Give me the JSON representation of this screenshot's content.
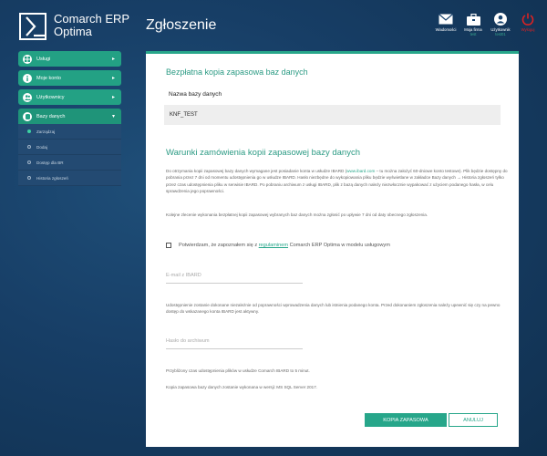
{
  "app": {
    "brand_line1": "Comarch ERP",
    "brand_line2": "Optima",
    "page_title": "Zgłoszenie"
  },
  "top_actions": [
    {
      "label": "Wiadomości",
      "sub": "",
      "icon": "envelope-icon"
    },
    {
      "label": "Moja firma",
      "sub": "test",
      "icon": "briefcase-icon"
    },
    {
      "label": "Użytkownik",
      "sub": "test01",
      "icon": "user-icon"
    },
    {
      "label": "Wyloguj",
      "sub": "",
      "icon": "power-icon"
    }
  ],
  "sidebar": {
    "items": [
      {
        "label": "Usługi",
        "icon": "grid-icon",
        "arrow": "▸"
      },
      {
        "label": "Moje konto",
        "icon": "info-icon",
        "arrow": "▸"
      },
      {
        "label": "Użytkownicy",
        "icon": "users-icon",
        "arrow": "▸"
      },
      {
        "label": "Bazy danych",
        "icon": "database-icon",
        "arrow": "▾"
      }
    ],
    "submenu": [
      {
        "label": "Zarządzaj",
        "current": true
      },
      {
        "label": "Dodaj",
        "current": false
      },
      {
        "label": "Dostęp dla BR",
        "current": false
      },
      {
        "label": "Historia zgłoszeń",
        "current": false
      }
    ]
  },
  "main": {
    "section1_title": "Bezpłatna kopia zapasowa baz danych",
    "table_header": "Nazwa bazy danych",
    "table_row": "KNF_TEST",
    "section2_title": "Warunki zamówienia kopii zapasowej bazy danych",
    "para1_a": "Do otrzymania kopii zapasowej bazy danych wymagane jest posiadanie konta w usłudze IBARD (",
    "para1_link": "www.ibard.com",
    "para1_b": " – tu można założyć 60-dniowe konto testowe). Plik będzie dostępny do pobrania przez 7 dni od momentu udostępnienia go w usłudze IBARD. Hasło niezbędne do wykopiowania pliku będzie wyświetlane w zakładce Bazy danych → Historia zgłoszeń tylko przez czas udostępnienia pliku w serwisie IBARD. Po pobraniu archiwum z usługi IBARD, plik z bazą danych należy niezwłocznie wypakować z użyciem podanego hasła, w celu sprawdzenia jego poprawności.",
    "para2": "Kolejne zlecenie wykonania bezpłatnej kopii zapasowej wybranych baz danych można zgłosić po upływie 7 dni od daty obecnego zgłoszenia.",
    "checkbox_a": "Potwierdzam, że zapoznałem się z ",
    "checkbox_link": "regulaminem",
    "checkbox_b": " Comarch ERP Optima w modelu usługowym",
    "email_placeholder": "E-mail z IBARD",
    "para3": "Udostępnienie zostanie dokonane niezależnie od poprawności wprowadzenia danych lub istnienia podanego konta. Przed dokonaniem zgłoszenia należy upewnić się czy na pewno dostęp do wskazanego konta IBARD jest aktywny.",
    "password_placeholder": "Hasło do archiwum",
    "para4": "Przybliżony czas udostępnienia plików w usłudze Comarch IBARD to 5 minut.",
    "para5": "Kopia zapasowa bazy danych zostanie wykonana w wersji: MS SQL Server 2017.",
    "btn_backup": "KOPIA ZAPASOWA",
    "btn_cancel": "ANULUJ"
  },
  "colors": {
    "accent": "#27a68a",
    "logout": "#dd2222"
  }
}
